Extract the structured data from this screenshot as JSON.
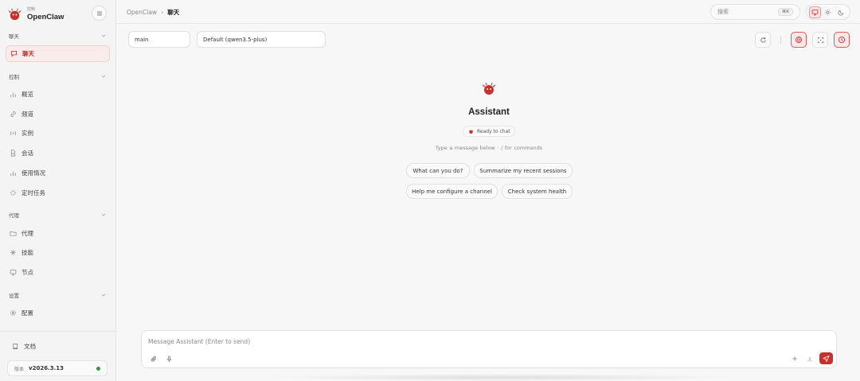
{
  "brand": {
    "subtitle": "控制",
    "name": "OpenClaw"
  },
  "sidebar": {
    "groups": [
      {
        "label": "聊天",
        "items": [
          {
            "label": "聊天",
            "icon": "chat-bubble-icon",
            "active": true
          }
        ]
      },
      {
        "label": "控制",
        "items": [
          {
            "label": "概览",
            "icon": "bar-chart-icon"
          },
          {
            "label": "频道",
            "icon": "link-icon"
          },
          {
            "label": "实例",
            "icon": "radio-icon"
          },
          {
            "label": "会话",
            "icon": "document-icon"
          },
          {
            "label": "使用情况",
            "icon": "bar-chart-icon"
          },
          {
            "label": "定时任务",
            "icon": "loader-icon"
          }
        ]
      },
      {
        "label": "代理",
        "items": [
          {
            "label": "代理",
            "icon": "folder-icon"
          },
          {
            "label": "技能",
            "icon": "sparkle-icon"
          },
          {
            "label": "节点",
            "icon": "monitor-icon"
          }
        ]
      },
      {
        "label": "设置",
        "items": [
          {
            "label": "配置",
            "icon": "gear-icon"
          }
        ]
      }
    ],
    "docs_label": "文档",
    "version_label": "版本",
    "version": "v2026.3.13"
  },
  "topbar": {
    "breadcrumb_root": "OpenClaw",
    "breadcrumb_sep": "›",
    "breadcrumb_current": "聊天",
    "search_placeholder": "搜索",
    "search_shortcut": "⌘K",
    "theme_modes": [
      "system-icon",
      "sun-icon",
      "moon-icon"
    ]
  },
  "chat": {
    "session": "main",
    "model": "Default (qwen3.5-plus)",
    "assistant_name": "Assistant",
    "status": "Ready to chat",
    "hint": "Type a message below · / for commands",
    "suggestions": [
      "What can you do?",
      "Summarize my recent sessions",
      "Help me configure a channel",
      "Check system health"
    ],
    "input_placeholder": "Message Assistant (Enter to send)"
  },
  "colors": {
    "accent": "#c9302c",
    "active_bg": "#fbecec",
    "status_online": "#2e9b42"
  }
}
